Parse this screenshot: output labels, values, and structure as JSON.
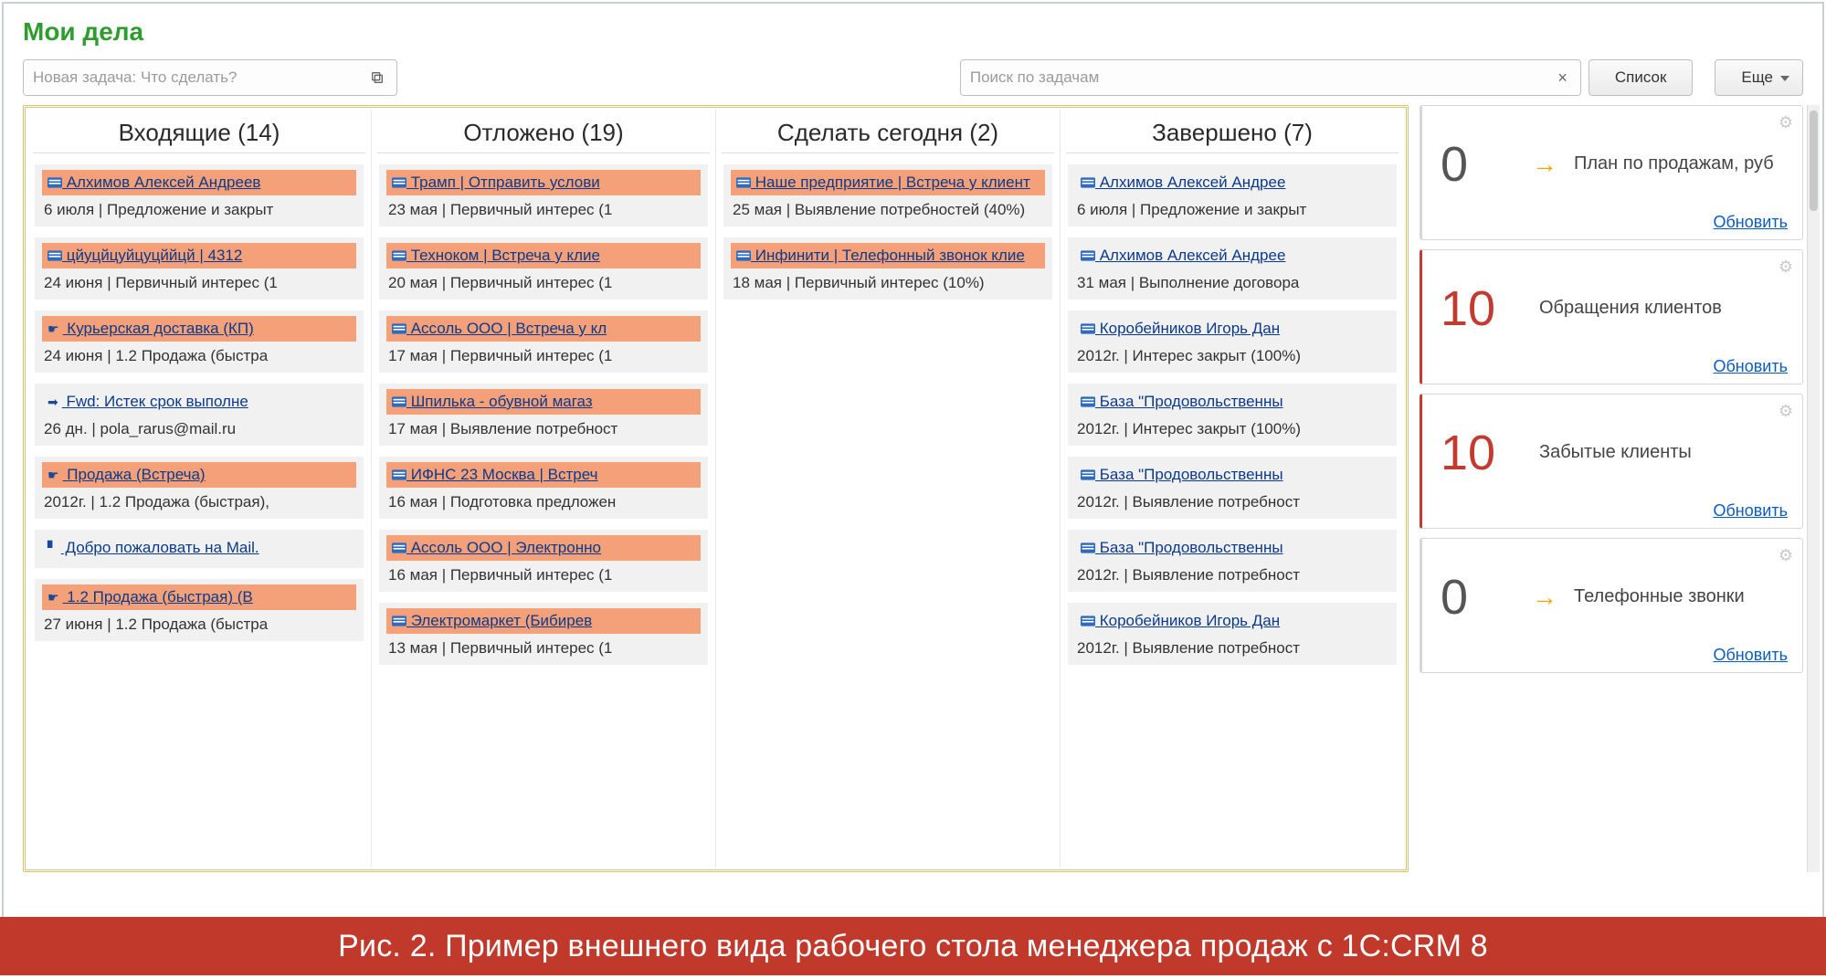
{
  "header": {
    "title": "Мои дела"
  },
  "toolbar": {
    "new_task_placeholder": "Новая задача: Что сделать?",
    "search_placeholder": "Поиск по задачам",
    "list_button": "Список",
    "more_button": "Еще"
  },
  "columns": [
    {
      "title": "Входящие (14)",
      "cards": [
        {
          "icon": "card",
          "bg": true,
          "title": "Алхимов Алексей Андреев",
          "sub": "6 июля | Предложение и закрыт"
        },
        {
          "icon": "card",
          "bg": true,
          "title": "цйуцйцуйцуцййцй | 4312",
          "sub": "24 июня | Первичный интерес (1"
        },
        {
          "icon": "tag",
          "bg": true,
          "title": "Курьерская доставка (КП)",
          "sub": "24 июня | 1.2 Продажа (быстра"
        },
        {
          "icon": "fwd",
          "bg": false,
          "title": "Fwd: Истек срок выполне",
          "sub": "26 дн. | pola_rarus@mail.ru"
        },
        {
          "icon": "tag",
          "bg": true,
          "title": "Продажа (Встреча)",
          "sub": "2012г. | 1.2 Продажа (быстрая),"
        },
        {
          "icon": "flag",
          "bg": false,
          "title": "Добро пожаловать на Mail.",
          "sub": ""
        },
        {
          "icon": "tag",
          "bg": true,
          "title": "1.2 Продажа (быстрая) (В",
          "sub": "27 июня | 1.2 Продажа (быстра"
        }
      ]
    },
    {
      "title": "Отложено (19)",
      "cards": [
        {
          "icon": "card",
          "bg": true,
          "title": "Трамп | Отправить услови",
          "sub": "23 мая | Первичный интерес (1"
        },
        {
          "icon": "card",
          "bg": true,
          "title": "Техноком | Встреча у клие",
          "sub": "20 мая | Первичный интерес (1"
        },
        {
          "icon": "card",
          "bg": true,
          "title": "Ассоль ООО | Встреча у кл",
          "sub": "17 мая | Первичный интерес (1"
        },
        {
          "icon": "card",
          "bg": true,
          "title": "Шпилька - обувной магаз",
          "sub": "17 мая | Выявление потребност"
        },
        {
          "icon": "card",
          "bg": true,
          "title": "ИФНС 23 Москва | Встреч",
          "sub": "16 мая | Подготовка предложен"
        },
        {
          "icon": "card",
          "bg": true,
          "title": "Ассоль ООО | Электронно",
          "sub": "16 мая | Первичный интерес (1"
        },
        {
          "icon": "card",
          "bg": true,
          "title": "Электромаркет (Бибирев",
          "sub": "13 мая | Первичный интерес (1"
        }
      ]
    },
    {
      "title": "Сделать сегодня (2)",
      "cards": [
        {
          "icon": "card",
          "bg": true,
          "title": "Наше предприятие | Встреча у клиент",
          "sub": "25 мая | Выявление потребностей (40%)"
        },
        {
          "icon": "card",
          "bg": true,
          "title": "Инфинити | Телефонный звонок клие",
          "sub": "18 мая | Первичный интерес (10%)"
        }
      ]
    },
    {
      "title": "Завершено (7)",
      "cards": [
        {
          "icon": "card",
          "bg": false,
          "title": "Алхимов Алексей Андрее",
          "sub": "6 июля | Предложение и закрыт"
        },
        {
          "icon": "card",
          "bg": false,
          "title": "Алхимов Алексей Андрее",
          "sub": "31 мая | Выполнение договора"
        },
        {
          "icon": "card",
          "bg": false,
          "title": "Коробейников Игорь Дан",
          "sub": "2012г. | Интерес закрыт (100%)"
        },
        {
          "icon": "card",
          "bg": false,
          "title": "База \"Продовольственны",
          "sub": "2012г. | Интерес закрыт (100%)"
        },
        {
          "icon": "card",
          "bg": false,
          "title": "База \"Продовольственны",
          "sub": "2012г. | Выявление потребност"
        },
        {
          "icon": "card",
          "bg": false,
          "title": "База \"Продовольственны",
          "sub": "2012г. | Выявление потребност"
        },
        {
          "icon": "card",
          "bg": false,
          "title": "Коробейников Игорь Дан",
          "sub": "2012г. | Выявление потребност"
        }
      ]
    }
  ],
  "side_panels": [
    {
      "red": false,
      "num": "0",
      "arrow": true,
      "label": "План по продажам, руб",
      "refresh": "Обновить"
    },
    {
      "red": true,
      "num": "10",
      "arrow": false,
      "label": "Обращения клиентов",
      "refresh": "Обновить"
    },
    {
      "red": true,
      "num": "10",
      "arrow": false,
      "label": "Забытые клиенты",
      "refresh": "Обновить"
    },
    {
      "red": false,
      "num": "0",
      "arrow": true,
      "label": "Телефонные звонки",
      "refresh": "Обновить"
    }
  ],
  "caption": "Рис. 2. Пример внешнего вида рабочего стола менеджера продаж с 1С:CRM 8"
}
